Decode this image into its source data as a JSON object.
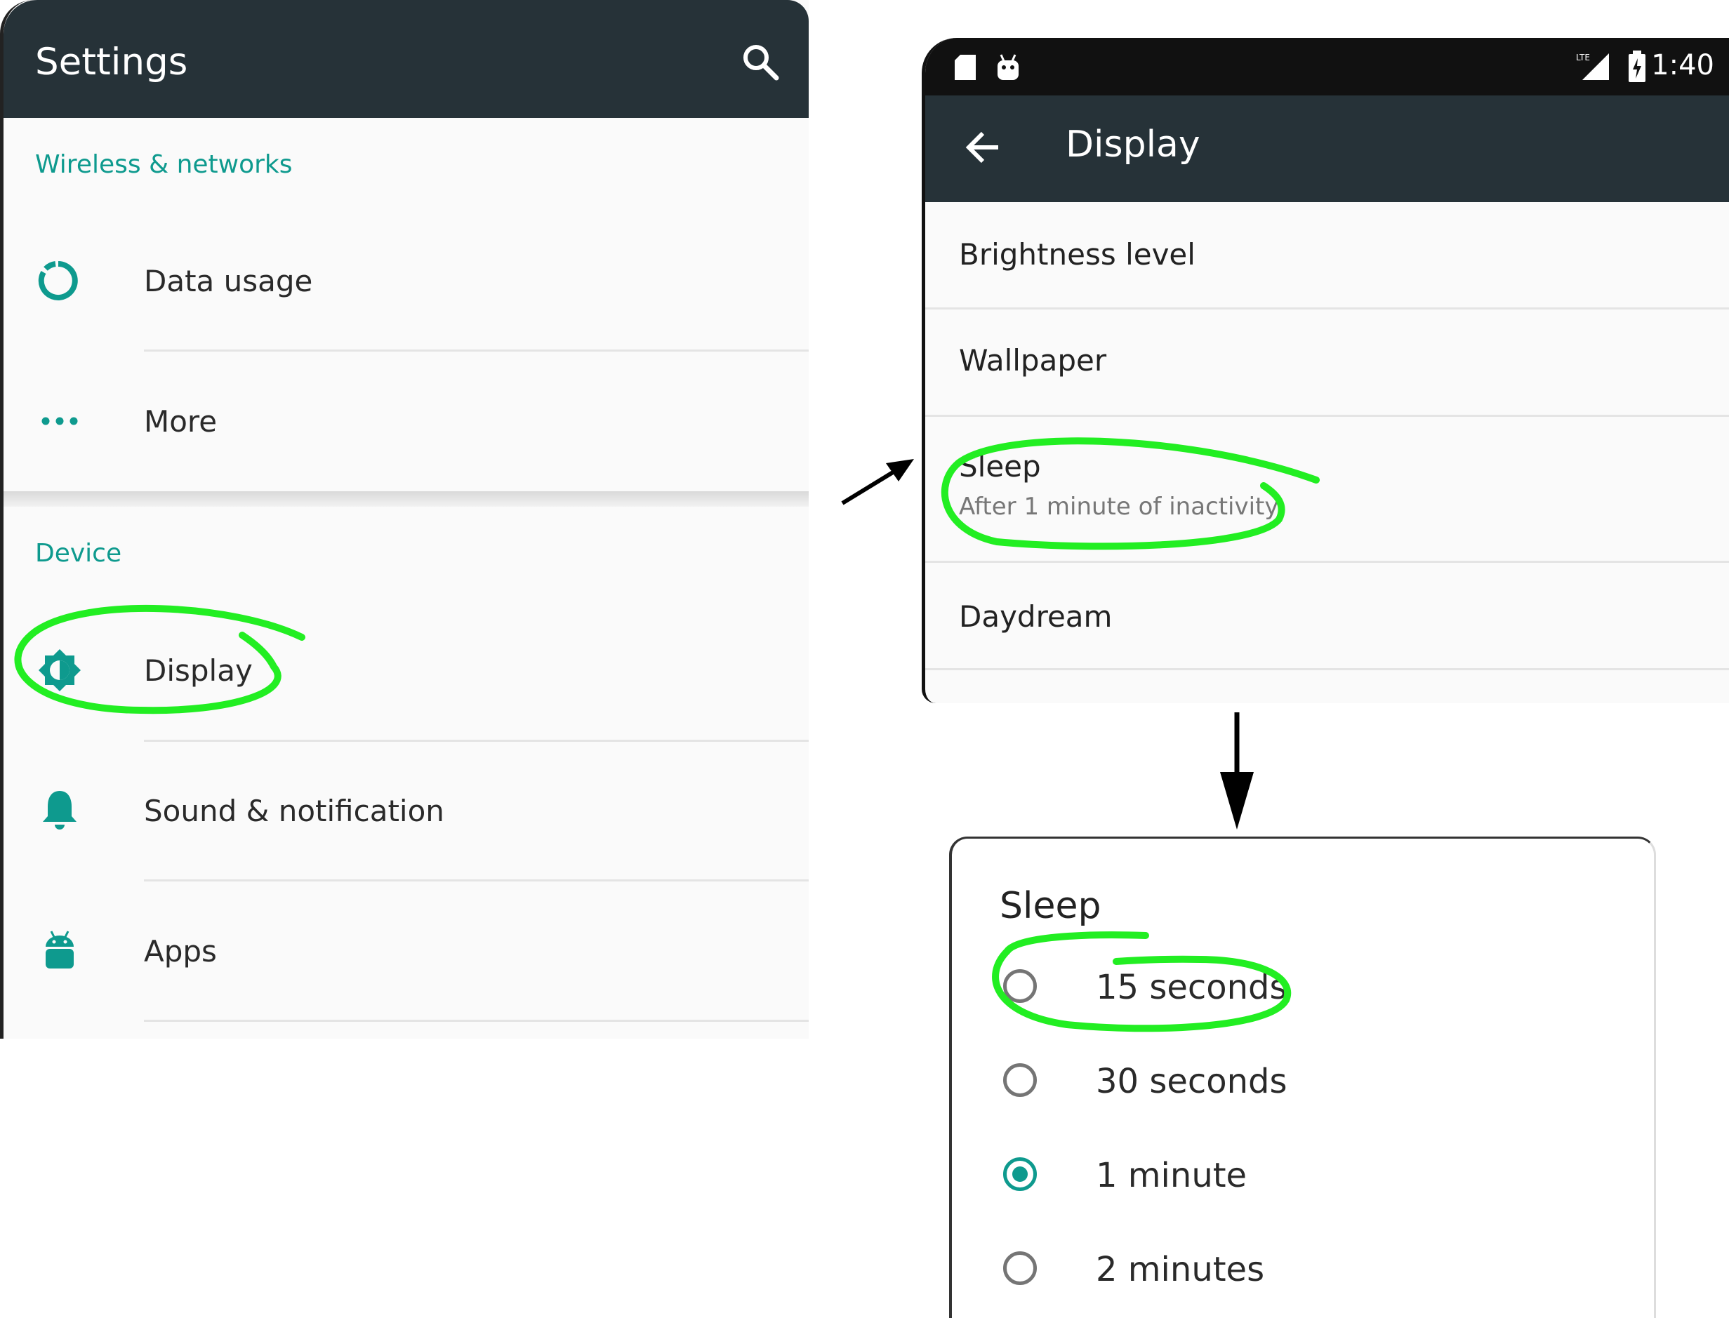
{
  "settings": {
    "title": "Settings",
    "sections": [
      {
        "header": "Wireless & networks"
      },
      {
        "header": "Device"
      }
    ],
    "items": [
      {
        "label": "Data usage",
        "icon": "data-usage-icon"
      },
      {
        "label": "More",
        "icon": "more-dots-icon"
      },
      {
        "label": "Display",
        "icon": "brightness-icon"
      },
      {
        "label": "Sound & notification",
        "icon": "bell-icon"
      },
      {
        "label": "Apps",
        "icon": "android-icon"
      }
    ]
  },
  "display": {
    "status_time": "1:40",
    "title": "Display",
    "items": [
      {
        "label": "Brightness level"
      },
      {
        "label": "Wallpaper"
      },
      {
        "label": "Sleep",
        "subtitle": "After 1 minute of inactivity"
      },
      {
        "label": "Daydream"
      }
    ]
  },
  "sleep_dialog": {
    "title": "Sleep",
    "options": [
      {
        "label": "15 seconds",
        "selected": false
      },
      {
        "label": "30 seconds",
        "selected": false
      },
      {
        "label": "1 minute",
        "selected": true
      },
      {
        "label": "2 minutes",
        "selected": false
      }
    ]
  },
  "colors": {
    "toolbar": "#263238",
    "accent": "#0e9a8e",
    "annotation": "#22ee22"
  }
}
